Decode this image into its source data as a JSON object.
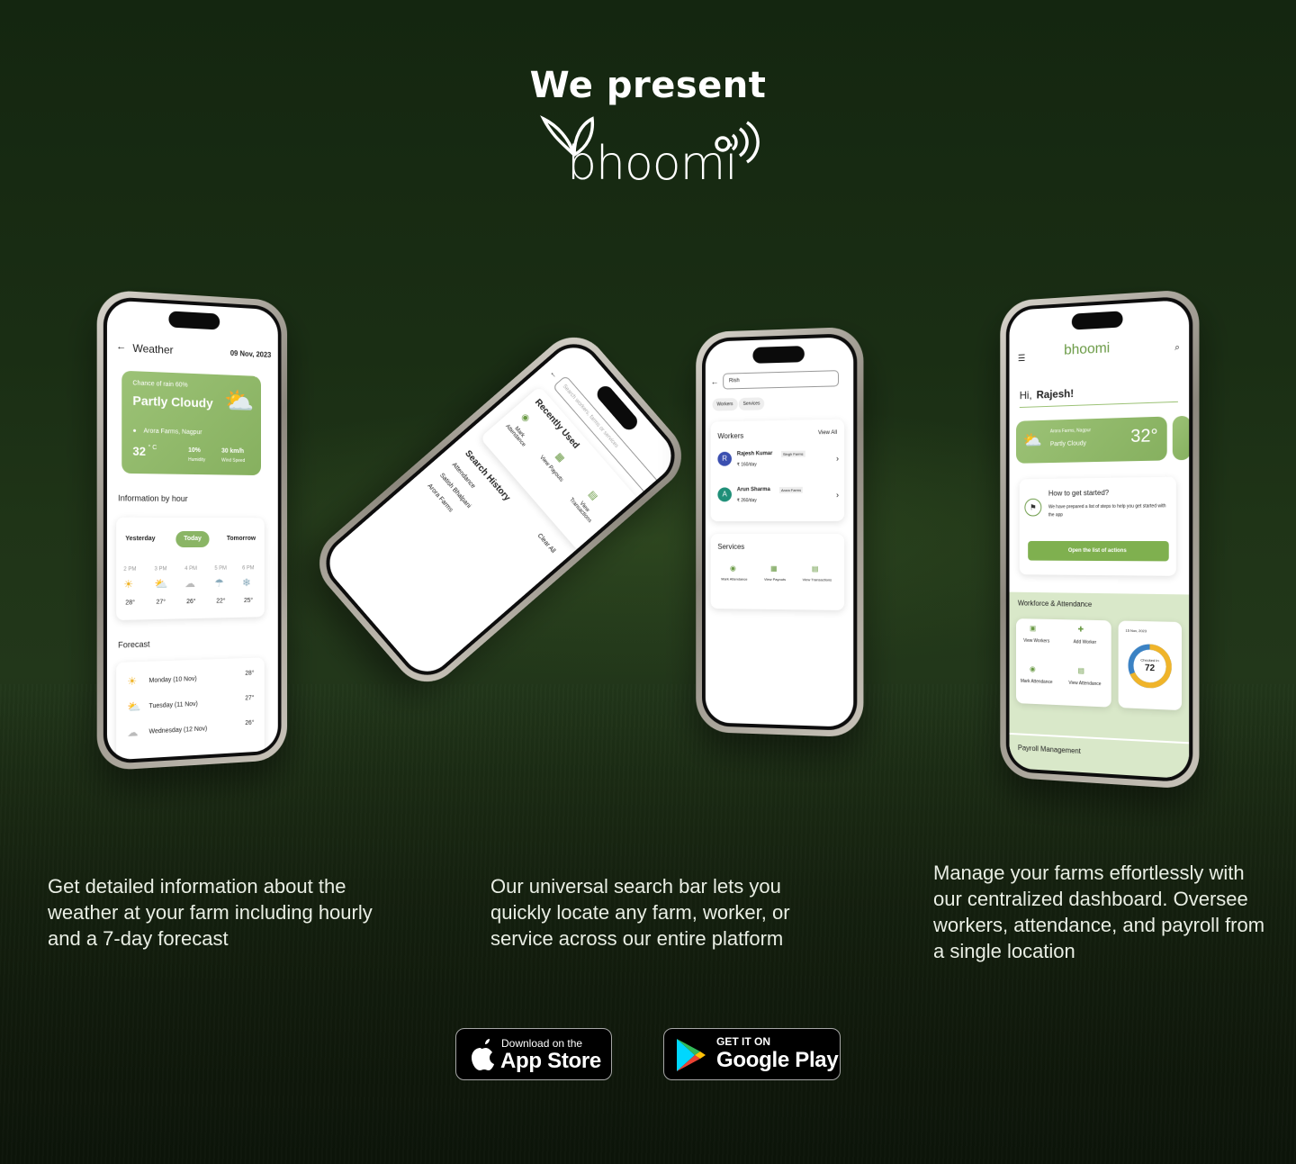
{
  "hero": {
    "title": "We present",
    "logo_text": "bhoomi"
  },
  "weather_screen": {
    "back_icon": "arrow-left-icon",
    "title": "Weather",
    "date": "09 Nov, 2023",
    "rain_chance": "Chance of rain 60%",
    "condition": "Partly Cloudy",
    "location": "Arora Farms, Nagpur",
    "temperature": "32",
    "temp_unit": "° C",
    "humidity_value": "10%",
    "humidity_label": "Humidity",
    "wind_value": "30 km/h",
    "wind_label": "Wind Speed",
    "hourly_heading": "Information by hour",
    "day_tabs": [
      "Yesterday",
      "Today",
      "Tomorrow"
    ],
    "hours": [
      {
        "time": "2 PM",
        "temp": "28°",
        "icon": "sun-icon"
      },
      {
        "time": "3 PM",
        "temp": "27°",
        "icon": "partly-cloudy-icon"
      },
      {
        "time": "4 PM",
        "temp": "26°",
        "icon": "cloud-icon"
      },
      {
        "time": "5 PM",
        "temp": "22°",
        "icon": "rain-icon"
      },
      {
        "time": "6 PM",
        "temp": "25°",
        "icon": "snow-icon"
      }
    ],
    "forecast_heading": "Forecast",
    "forecast": [
      {
        "day": "Monday (10 Nov)",
        "temp": "28°",
        "icon": "sun-icon"
      },
      {
        "day": "Tuesday (11 Nov)",
        "temp": "27°",
        "icon": "partly-cloudy-icon"
      },
      {
        "day": "Wednesday (12 Nov)",
        "temp": "26°",
        "icon": "cloud-icon"
      }
    ]
  },
  "search_screen": {
    "placeholder": "Search workers, farms or services",
    "recently_used_heading": "Recently Used",
    "recent_items": [
      "Mark Attendance",
      "View Payouts",
      "View Transactions"
    ],
    "history_heading": "Search History",
    "clear_label": "Clear All",
    "history_items": [
      "Attendance",
      "Satish Bhalpani",
      "Arora Farms"
    ]
  },
  "workers_screen": {
    "query": "Rish",
    "filters": [
      "Workers",
      "Services"
    ],
    "workers_heading": "Workers",
    "view_all": "View All",
    "workers": [
      {
        "initial": "R",
        "name": "Rajesh Kumar",
        "farm": "Singh Farms",
        "rate": "₹ 160/day",
        "color": "#3b4fb0"
      },
      {
        "initial": "A",
        "name": "Arun Sharma",
        "farm": "Arora Farms",
        "rate": "₹ 260/day",
        "color": "#1f8f78"
      }
    ],
    "services_heading": "Services",
    "services": [
      "Mark Attendance",
      "View Payouts",
      "View Transactions"
    ]
  },
  "dashboard_screen": {
    "logo_text": "bhoomi",
    "greeting_prefix": "Hi,",
    "greeting_name": "Rajesh!",
    "location": "Arora Farms, Nagpur",
    "condition": "Partly Cloudy",
    "temperature": "32°",
    "getting_started_title": "How to get started?",
    "getting_started_body": "We have prepared a list of steps to help you get started with the app",
    "getting_started_button": "Open the list of actions",
    "workforce_heading": "Workforce & Attendance",
    "workforce_actions": [
      "View Workers",
      "Add Worker",
      "Mark Attendance",
      "View Attendance"
    ],
    "attendance_date": "15 Nov, 2023",
    "checked_in_label": "Checked In",
    "checked_in_value": "72",
    "payroll_heading": "Payroll Management"
  },
  "descriptions": {
    "weather": "Get detailed information about the weather at your farm including hourly and a 7-day forecast",
    "search": "Our universal search bar lets you quickly locate any farm, worker, or service across our entire platform",
    "dashboard": "Manage your farms effortlessly with our centralized dashboard. Oversee workers, attendance, and payroll from a single location"
  },
  "stores": {
    "apple_line1": "Download on the",
    "apple_line2": "App Store",
    "google_line1": "GET IT ON",
    "google_line2": "Google Play"
  },
  "colors": {
    "accent_green": "#8ab565",
    "background_dark": "#142610",
    "ring_yellow": "#f0b429",
    "ring_blue": "#3b82c4"
  }
}
